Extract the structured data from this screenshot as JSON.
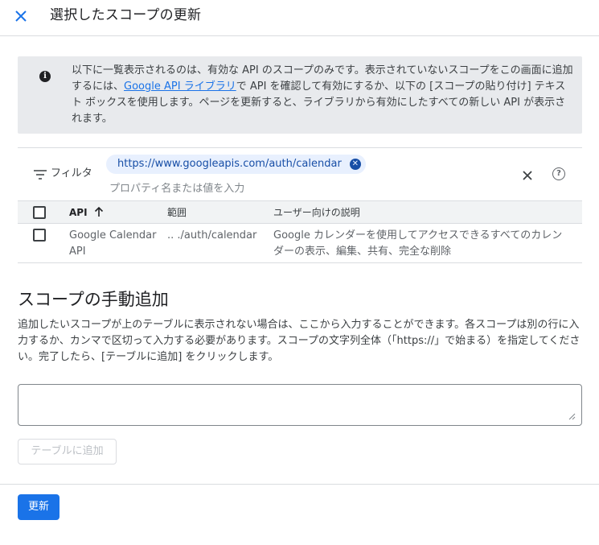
{
  "header": {
    "title": "選択したスコープの更新",
    "close_icon": "close-icon"
  },
  "info": {
    "icon": "info-icon",
    "text_before_link": "以下に一覧表示されるのは、有効な API のスコープのみです。表示されていないスコープをこの画面に追加するには、",
    "link": "Google API ライブラリ",
    "text_after_link": "で API を確認して有効にするか、以下の [スコープの貼り付け] テキスト ボックスを使用します。ページを更新すると、ライブラリから有効にしたすべての新しい API が表示されます。"
  },
  "filter": {
    "label": "フィルタ",
    "chip": "https://www.googleapis.com/auth/calendar",
    "placeholder": "プロパティ名または値を入力"
  },
  "table": {
    "columns": {
      "api": "API",
      "scope": "範囲",
      "description": "ユーザー向けの説明"
    },
    "rows": [
      {
        "api": "Google Calendar API",
        "scope": ".. ./auth/calendar",
        "description": "Google カレンダーを使用してアクセスできるすべてのカレンダーの表示、編集、共有、完全な削除"
      }
    ]
  },
  "manual": {
    "title": "スコープの手動追加",
    "description": "追加したいスコープが上のテーブルに表示されない場合は、ここから入力することができます。各スコープは別の行に入力するか、カンマで区切って入力する必要があります。スコープの文字列全体（「https://」で始まる）を指定してください。完了したら、[テーブルに追加] をクリックします。",
    "textarea_value": "",
    "add_button": "テーブルに追加"
  },
  "footer": {
    "update_button": "更新"
  },
  "colors": {
    "accent": "#1a73e8",
    "info_bg": "#e8eaed",
    "chip_bg": "#e8f0fe",
    "chip_text": "#174ea6"
  }
}
